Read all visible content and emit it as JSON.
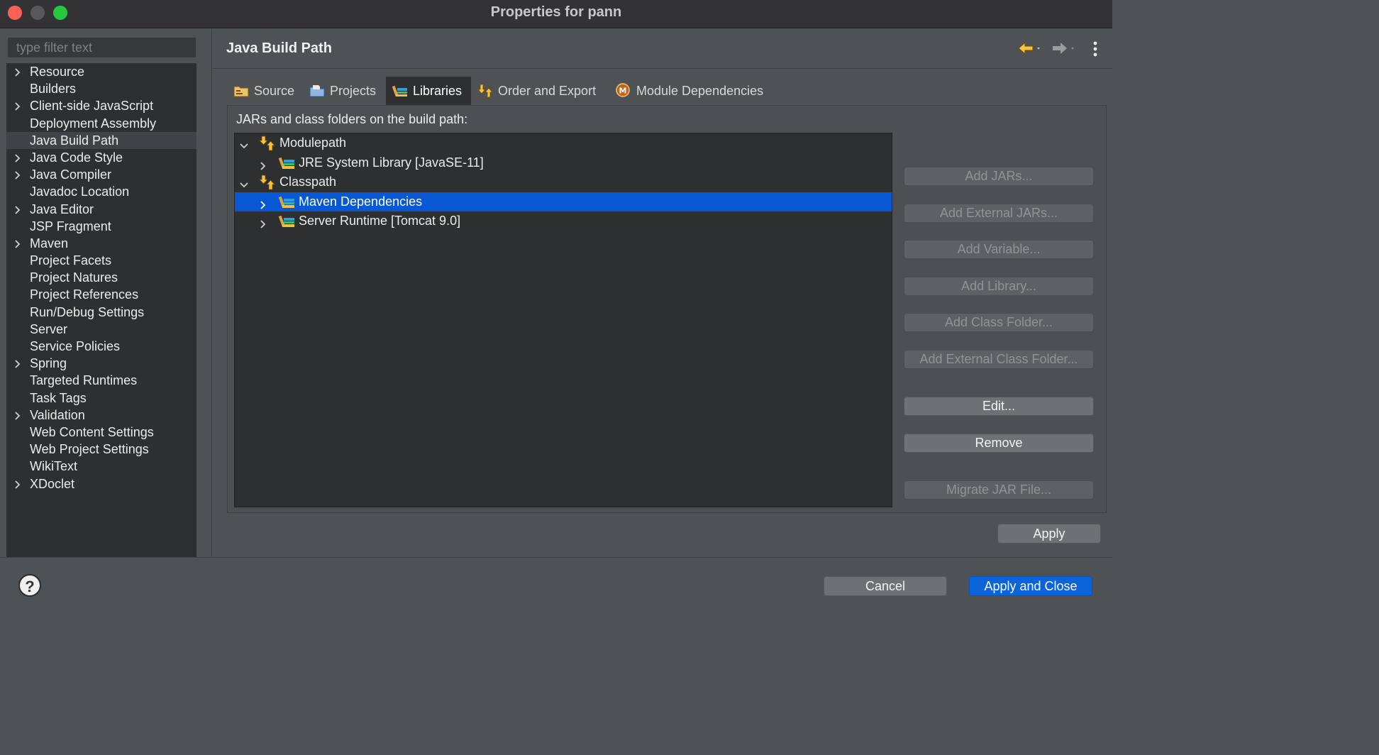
{
  "window": {
    "title": "Properties for pann"
  },
  "filter": {
    "placeholder": "type filter text"
  },
  "sidebar": {
    "items": [
      {
        "label": "Resource",
        "expandable": true
      },
      {
        "label": "Builders",
        "expandable": false
      },
      {
        "label": "Client-side JavaScript",
        "expandable": true
      },
      {
        "label": "Deployment Assembly",
        "expandable": false
      },
      {
        "label": "Java Build Path",
        "expandable": false,
        "selected": true
      },
      {
        "label": "Java Code Style",
        "expandable": true
      },
      {
        "label": "Java Compiler",
        "expandable": true
      },
      {
        "label": "Javadoc Location",
        "expandable": false
      },
      {
        "label": "Java Editor",
        "expandable": true
      },
      {
        "label": "JSP Fragment",
        "expandable": false
      },
      {
        "label": "Maven",
        "expandable": true
      },
      {
        "label": "Project Facets",
        "expandable": false
      },
      {
        "label": "Project Natures",
        "expandable": false
      },
      {
        "label": "Project References",
        "expandable": false
      },
      {
        "label": "Run/Debug Settings",
        "expandable": false
      },
      {
        "label": "Server",
        "expandable": false
      },
      {
        "label": "Service Policies",
        "expandable": false
      },
      {
        "label": "Spring",
        "expandable": true
      },
      {
        "label": "Targeted Runtimes",
        "expandable": false
      },
      {
        "label": "Task Tags",
        "expandable": false
      },
      {
        "label": "Validation",
        "expandable": true
      },
      {
        "label": "Web Content Settings",
        "expandable": false
      },
      {
        "label": "Web Project Settings",
        "expandable": false
      },
      {
        "label": "WikiText",
        "expandable": false
      },
      {
        "label": "XDoclet",
        "expandable": true
      }
    ]
  },
  "page": {
    "title": "Java Build Path"
  },
  "tabs": [
    {
      "label": "Source",
      "icon": "source-folder-icon"
    },
    {
      "label": "Projects",
      "icon": "projects-folder-icon"
    },
    {
      "label": "Libraries",
      "icon": "libraries-icon",
      "active": true
    },
    {
      "label": "Order and Export",
      "icon": "order-export-icon"
    },
    {
      "label": "Module Dependencies",
      "icon": "module-dependencies-icon"
    }
  ],
  "libraries": {
    "label": "JARs and class folders on the build path:",
    "rows": [
      {
        "label": "Modulepath",
        "level": 0,
        "expanded": true,
        "icon": "path-arrows-icon"
      },
      {
        "label": "JRE System Library [JavaSE-11]",
        "level": 1,
        "expanded": false,
        "icon": "library-icon"
      },
      {
        "label": "Classpath",
        "level": 0,
        "expanded": true,
        "icon": "path-arrows-icon"
      },
      {
        "label": "Maven Dependencies",
        "level": 1,
        "expanded": false,
        "icon": "library-icon",
        "selected": true
      },
      {
        "label": "Server Runtime [Tomcat 9.0]",
        "level": 1,
        "expanded": false,
        "icon": "library-icon"
      }
    ]
  },
  "buttons": {
    "add_jars": "Add JARs...",
    "add_external_jars": "Add External JARs...",
    "add_variable": "Add Variable...",
    "add_library": "Add Library...",
    "add_class_folder": "Add Class Folder...",
    "add_external_class_folder": "Add External Class Folder...",
    "edit": "Edit...",
    "remove": "Remove",
    "migrate_jar": "Migrate JAR File...",
    "apply": "Apply",
    "cancel": "Cancel",
    "apply_and_close": "Apply and Close",
    "help": "?"
  },
  "colors": {
    "selection": "#0758d2",
    "primary_button": "#0b63d9",
    "tree_background": "#2d2f30"
  }
}
